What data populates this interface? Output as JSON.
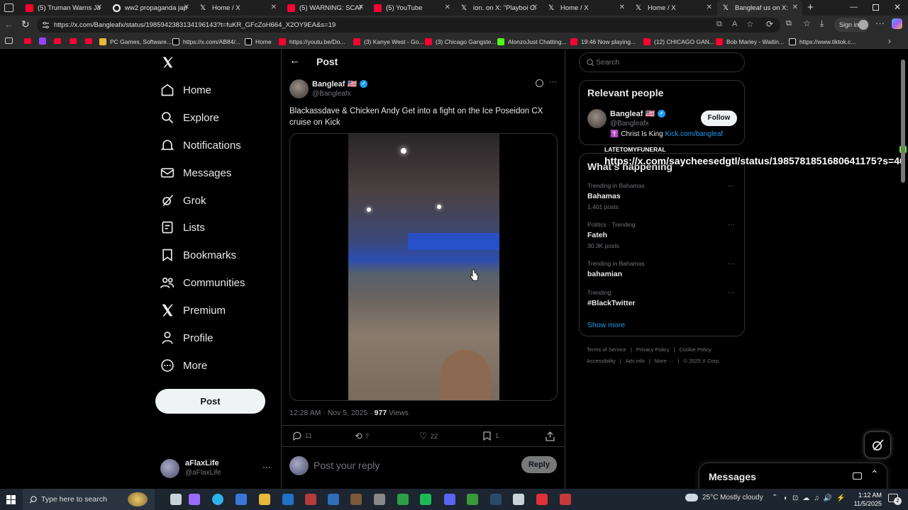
{
  "browser": {
    "tabs": [
      {
        "label": "(5) Truman Warns Japa",
        "icon": "youtube-icon",
        "color": "#ff0033"
      },
      {
        "label": "ww2 propaganda japa",
        "icon": "google-icon",
        "color": "#ffffff"
      },
      {
        "label": "Home / X",
        "icon": "x-icon",
        "color": "#ffffff"
      },
      {
        "label": "(5) WARNING: SCARIES",
        "icon": "youtube-icon",
        "color": "#ff0033"
      },
      {
        "label": "(5) YouTube",
        "icon": "youtube-icon",
        "color": "#ff0033"
      },
      {
        "label": "ion. on X: \"Playboi Cart",
        "icon": "x-icon",
        "color": "#ffffff"
      },
      {
        "label": "Home / X",
        "icon": "x-icon",
        "color": "#ffffff"
      },
      {
        "label": "Home / X",
        "icon": "x-icon",
        "color": "#ffffff"
      },
      {
        "label": "Bangleaf us on X:",
        "icon": "x-icon",
        "color": "#ffffff",
        "active": true
      }
    ],
    "url": "https://x.com/Bangleafx/status/1985942383134196143?t=fuKR_GFcZoH664_X2OY9EA&s=19",
    "signin_label": "Sign in",
    "bookmarks": [
      {
        "label": "PC Games, Software...",
        "icon": "folder-icon"
      },
      {
        "label": "https://x.com/AB84/...",
        "icon": "x-icon"
      },
      {
        "label": "Home",
        "icon": "x-icon"
      },
      {
        "label": "https://youtu.be/Do...",
        "icon": "youtube-icon"
      },
      {
        "label": "(3) Kanye West - Go...",
        "icon": "youtube-icon"
      },
      {
        "label": "(3) Chicago Gangste...",
        "icon": "youtube-icon"
      },
      {
        "label": "AlonzoJust Chatting...",
        "icon": "kick-icon"
      },
      {
        "label": "19:46 Now playing...",
        "icon": "youtube-icon"
      },
      {
        "label": "(12) CHICAGO GAN...",
        "icon": "youtube-icon"
      },
      {
        "label": "Bob Marley - Waitin...",
        "icon": "youtube-icon"
      },
      {
        "label": "https://www.tiktok.c...",
        "icon": "tiktok-icon"
      }
    ]
  },
  "nav": {
    "items": [
      {
        "label": "Home",
        "icon": "home-icon"
      },
      {
        "label": "Explore",
        "icon": "search-icon"
      },
      {
        "label": "Notifications",
        "icon": "bell-icon"
      },
      {
        "label": "Messages",
        "icon": "mail-icon"
      },
      {
        "label": "Grok",
        "icon": "grok-icon"
      },
      {
        "label": "Lists",
        "icon": "list-icon"
      },
      {
        "label": "Bookmarks",
        "icon": "bookmark-icon"
      },
      {
        "label": "Communities",
        "icon": "people-icon"
      },
      {
        "label": "Premium",
        "icon": "x-icon"
      },
      {
        "label": "Profile",
        "icon": "person-icon"
      },
      {
        "label": "More",
        "icon": "more-circle-icon"
      }
    ],
    "post_label": "Post",
    "account": {
      "name": "aFlaxLife",
      "handle": "@aFlaxLife"
    }
  },
  "post": {
    "header_title": "Post",
    "author_name": "Bangleaf 🇺🇸",
    "author_handle": "@Bangleafx",
    "text": "Blackassdave & Chicken Andy Get into a fight on the Ice Poseidon CX cruise on Kick",
    "time": "12:28 AM · Nov 5, 2025 · ",
    "views_count": "977",
    "views_label": " Views",
    "replies": "11",
    "reposts": "7",
    "likes": "22",
    "bookmarks": "1",
    "reply_placeholder": "Post your reply",
    "reply_button": "Reply"
  },
  "sidebar": {
    "search_placeholder": "Search",
    "relevant_title": "Relevant people",
    "person": {
      "name": "Bangleaf 🇺🇸",
      "handle": "@Bangleafx",
      "bio_text": "✝️ Christ Is King ",
      "bio_link": "Kick.com/bangleaf",
      "follow_label": "Follow"
    },
    "happening_title": "What's happening",
    "trends": [
      {
        "context": "Trending in Bahamas",
        "name": "Bahamas",
        "count": "1,401 posts"
      },
      {
        "context": "Politics · Trending",
        "name": "Fateh",
        "count": "30.3K posts"
      },
      {
        "context": "Trending in Bahamas",
        "name": "bahamian",
        "count": ""
      },
      {
        "context": "Trending",
        "name": "#BlackTwitter",
        "count": ""
      }
    ],
    "show_more": "Show more",
    "footer": [
      "Terms of Service",
      "Privacy Policy",
      "Cookie Policy",
      "Accessibility",
      "Ads info",
      "More ···",
      "© 2025 X Corp."
    ]
  },
  "tooltip": {
    "title": "LATETOMYFUNERAL",
    "url": "https://x.com/saycheesedgtl/status/1985781851680641175?s=46"
  },
  "messages_bar": {
    "title": "Messages"
  },
  "taskbar": {
    "search_placeholder": "Type here to search",
    "weather_temp": "25°C",
    "weather_text": "Mostly cloudy",
    "time": "1:12 AM",
    "date": "11/5/2025",
    "notification_count": "2"
  }
}
